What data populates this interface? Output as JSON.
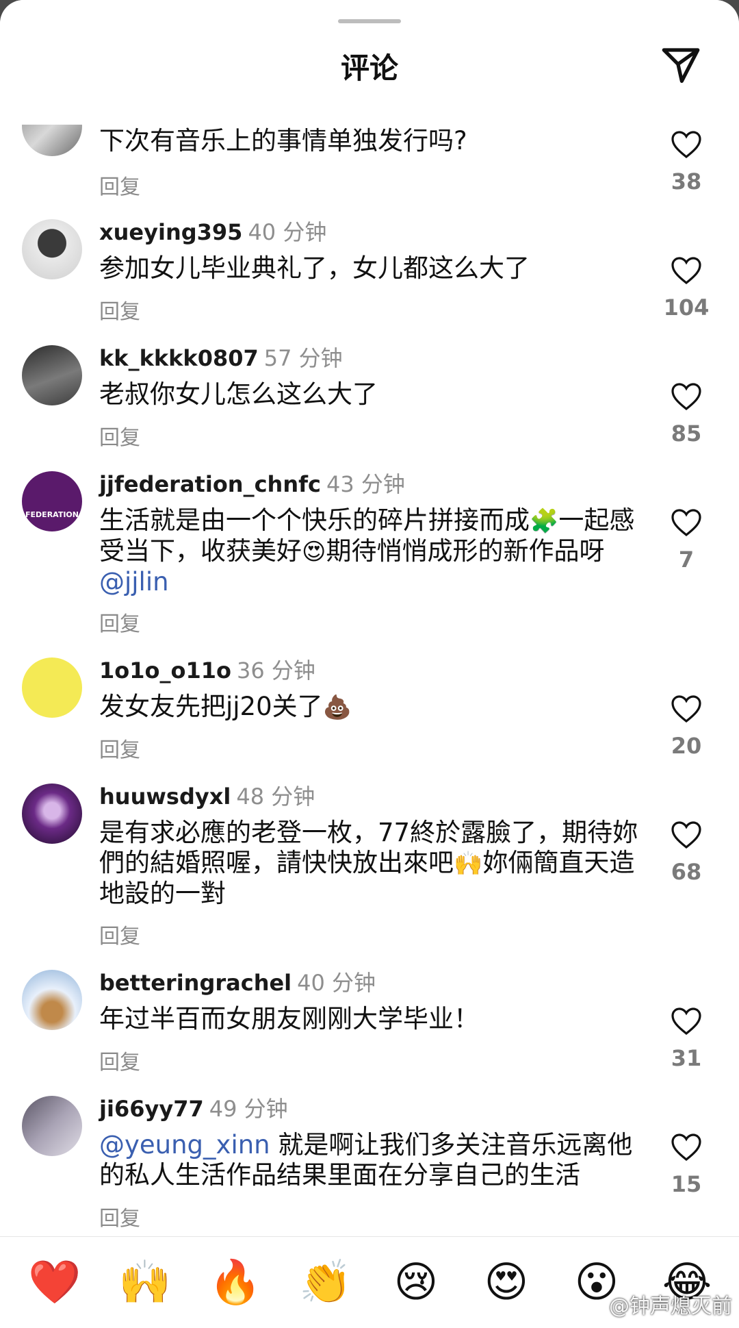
{
  "header": {
    "title": "评论"
  },
  "reply_label": "回复",
  "comments": [
    {
      "username": "",
      "time": "",
      "text": "下次有音乐上的事情单独发行吗?",
      "likes": "38"
    },
    {
      "username": "xueying395",
      "time": "40 分钟",
      "text": "参加女儿毕业典礼了，女儿都这么大了",
      "likes": "104"
    },
    {
      "username": "kk_kkkk0807",
      "time": "57 分钟",
      "text": "老叔你女儿怎么这么大了",
      "likes": "85"
    },
    {
      "username": "jjfederation_chnfc",
      "time": "43 分钟",
      "text_a": "生活就是由一个个快乐的碎片拼接而成",
      "emoji_a": "🧩",
      "text_b": "一起感受当下，收获美好",
      "emoji_b": "😍",
      "text_c": "期待悄悄成形的新作品呀 ",
      "mention": "@jjlin",
      "avatar_text": "FEDERATION",
      "likes": "7"
    },
    {
      "username": "1o1o_o11o",
      "time": "36 分钟",
      "text": "发女友先把jj20关了",
      "emoji": "💩",
      "likes": "20"
    },
    {
      "username": "huuwsdyxl",
      "time": "48 分钟",
      "text_a": "是有求必應的老登一枚，77終於露臉了，期待妳們的結婚照喔，請快快放出來吧",
      "emoji": "🙌",
      "text_b": "妳倆簡直天造地設的一對",
      "likes": "68"
    },
    {
      "username": "betteringrachel",
      "time": "40 分钟",
      "text": "年过半百而女朋友刚刚大学毕业！",
      "likes": "31"
    },
    {
      "username": "ji66yy77",
      "time": "49 分钟",
      "mention": "@yeung_xinn",
      "text": " 就是啊让我们多关注音乐远离他的私人生活作品结果里面在分享自己的生活",
      "likes": "15"
    }
  ],
  "reactions": [
    "❤️",
    "🙌",
    "🔥",
    "👏",
    "😢",
    "😍",
    "😮",
    "😂"
  ],
  "watermark": "@钟声熄灭前",
  "colors": {
    "avatar_purple": "#5a1a6b",
    "avatar_yellow": "#f4ea55",
    "mention": "#3a5fb0"
  }
}
